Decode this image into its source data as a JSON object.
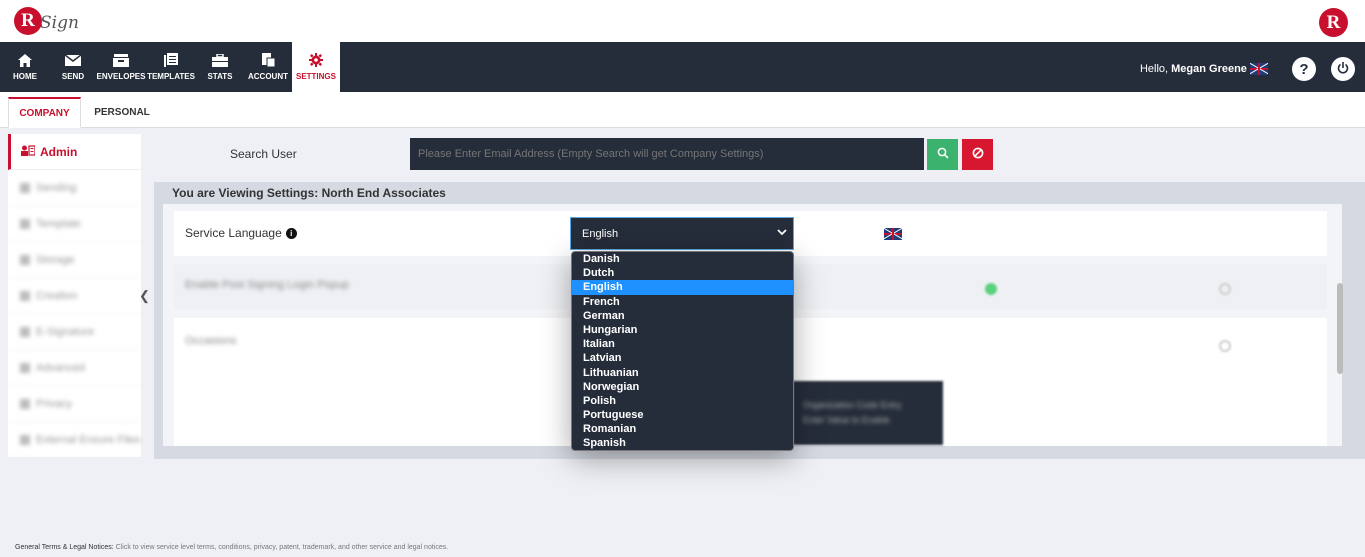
{
  "brand": {
    "logo_letter": "R",
    "logo_word": "Sign",
    "right_logo_letter": "R"
  },
  "nav": {
    "items": [
      {
        "label": "HOME",
        "icon": "home-icon"
      },
      {
        "label": "SEND",
        "icon": "envelope-icon"
      },
      {
        "label": "ENVELOPES",
        "icon": "inbox-icon"
      },
      {
        "label": "TEMPLATES",
        "icon": "templates-icon"
      },
      {
        "label": "STATS",
        "icon": "briefcase-icon"
      },
      {
        "label": "ACCOUNT",
        "icon": "account-icon"
      },
      {
        "label": "SETTINGS",
        "icon": "gear-icon"
      }
    ],
    "active": "SETTINGS",
    "hello_prefix": "Hello,",
    "user_name": "Megan Greene",
    "help_icon": "?",
    "power_icon": "power-icon"
  },
  "tabs": [
    {
      "label": "COMPANY",
      "active": true
    },
    {
      "label": "PERSONAL",
      "active": false
    }
  ],
  "sidebar": {
    "active_label": "Admin",
    "blurred_items": [
      "Sending",
      "Template",
      "Storage",
      "Creation",
      "E-Signature",
      "Advanced",
      "Privacy",
      "External Ensure Files"
    ]
  },
  "search": {
    "label": "Search User",
    "placeholder": "Please Enter Email Address (Empty Search will get Company Settings)"
  },
  "panel": {
    "title": "You are Viewing Settings: North End Associates",
    "service_language_label": "Service Language",
    "selected_language": "English",
    "blurred_row2": "Enable Post Signing Login Popup",
    "blurred_row3": "Occasions",
    "blurred_dark_box": "Organization Code Entry",
    "blurred_dark_box_2": "Enter Value to Enable"
  },
  "dropdown": {
    "options": [
      "Danish",
      "Dutch",
      "English",
      "French",
      "German",
      "Hungarian",
      "Italian",
      "Latvian",
      "Lithuanian",
      "Norwegian",
      "Polish",
      "Portuguese",
      "Romanian",
      "Spanish"
    ],
    "selected": "English"
  },
  "footer": {
    "heading": "General Terms & Legal Notices:",
    "text": "Click to view service level terms, conditions, privacy, patent, trademark, and other service and legal notices."
  },
  "colors": {
    "brand_red": "#c8102e",
    "navbar": "#262d3a",
    "search_green": "#3bb36e",
    "clear_red": "#d7172f",
    "selected_blue": "#1e90ff"
  }
}
